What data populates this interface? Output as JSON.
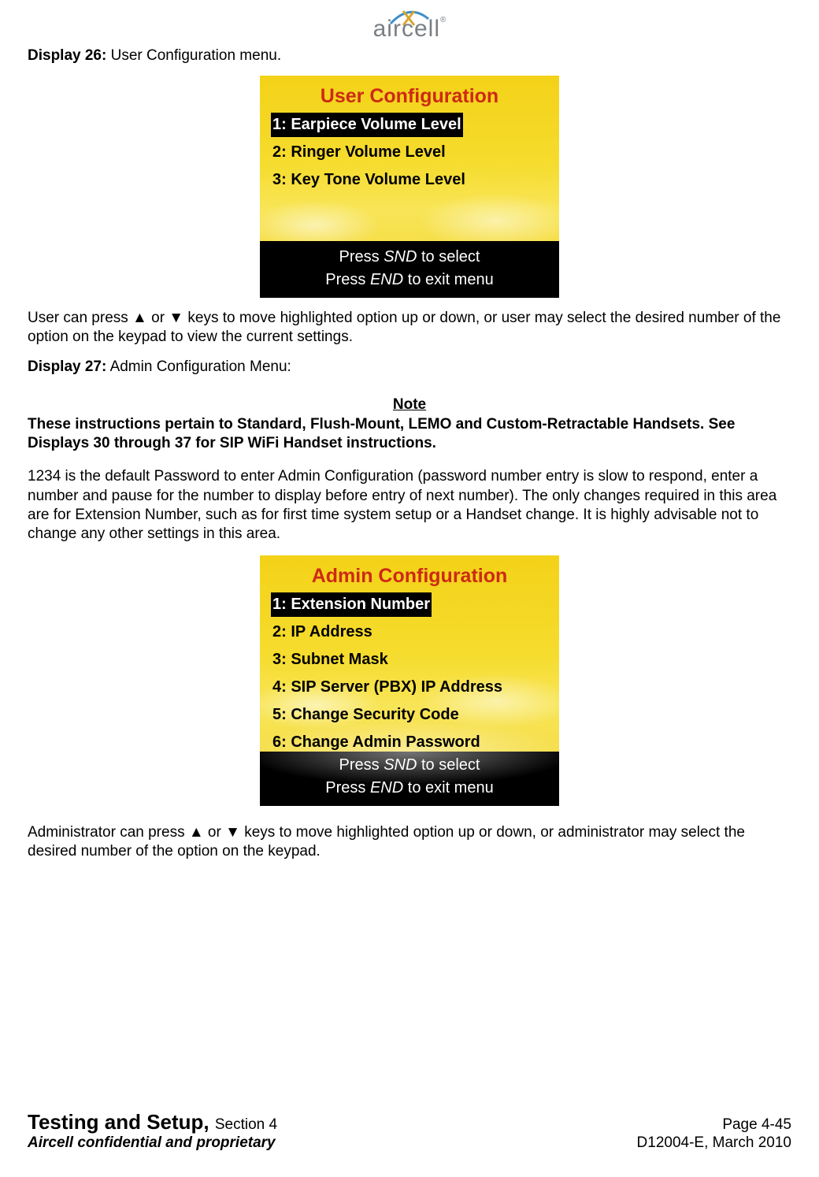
{
  "logo": {
    "text": "aircell"
  },
  "display26": {
    "label": "Display 26:",
    "caption": "User Configuration menu."
  },
  "userScreen": {
    "title": "User Configuration",
    "items": [
      "1: Earpiece Volume Level",
      "2: Ringer Volume Level",
      "3: Key Tone Volume Level"
    ],
    "footer1_a": "Press ",
    "footer1_b": "SND",
    "footer1_c": " to select",
    "footer2_a": "Press ",
    "footer2_b": "END",
    "footer2_c": " to exit menu"
  },
  "userParagraph": "User can press ▲ or ▼ keys to move highlighted option up or down, or user may select the desired number of the option on the keypad to view the current settings.",
  "display27": {
    "label": "Display 27:",
    "caption": "Admin Configuration Menu:"
  },
  "note": {
    "heading": "Note",
    "body": "These instructions pertain to Standard, Flush-Mount, LEMO and Custom-Retractable Handsets.  See Displays 30 through 37 for SIP WiFi Handset instructions."
  },
  "adminIntro": "1234 is the default Password to enter Admin Configuration (password number entry is slow to respond, enter a number and pause for the number to display before entry of next number).  The only changes required in this area are for Extension Number, such as for first time system setup or a Handset change.  It is highly advisable not to change any other settings in this area.",
  "adminScreen": {
    "title": "Admin Configuration",
    "items": [
      "1: Extension Number",
      "2: IP Address",
      "3: Subnet Mask",
      "4: SIP Server (PBX) IP Address",
      "5: Change Security Code",
      "6: Change Admin Password"
    ],
    "footer1_a": "Press ",
    "footer1_b": "SND",
    "footer1_c": " to select",
    "footer2_a": "Press ",
    "footer2_b": "END",
    "footer2_c": " to exit menu"
  },
  "adminParagraph": "Administrator can press ▲ or ▼ keys to move highlighted option up or down, or administrator may select the desired number of the option on the keypad.",
  "footer": {
    "title": "Testing and Setup, ",
    "section": "Section 4",
    "page": "Page 4-45",
    "confidential": "Aircell confidential and proprietary",
    "docid": "D12004-E, March 2010"
  }
}
